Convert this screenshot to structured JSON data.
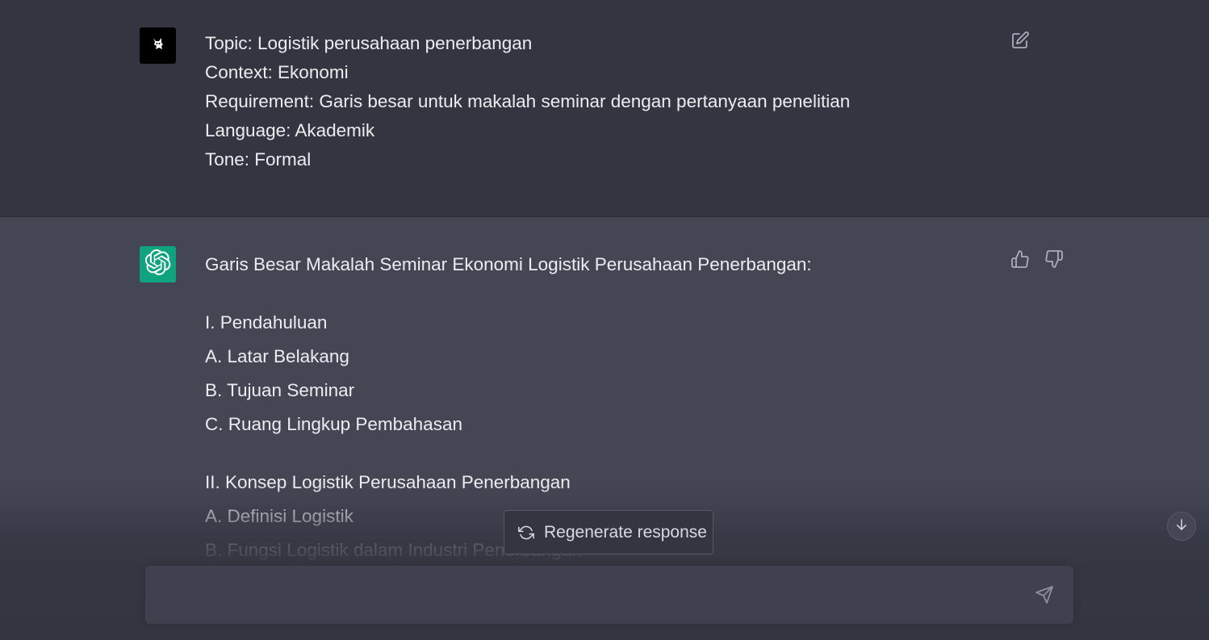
{
  "conversation": {
    "user_message": {
      "avatar_icon": "cat-avatar-icon",
      "lines": [
        "Topic: Logistik perusahaan penerbangan",
        "Context: Ekonomi",
        "Requirement: Garis besar untuk makalah seminar dengan pertanyaan penelitian",
        "Language: Akademik",
        "Tone: Formal"
      ]
    },
    "assistant_message": {
      "avatar_icon": "openai-logo-icon",
      "heading": "Garis Besar Makalah Seminar Ekonomi Logistik Perusahaan Penerbangan:",
      "sections": [
        {
          "title": "I. Pendahuluan",
          "items": [
            "A. Latar Belakang",
            "B. Tujuan Seminar",
            "C. Ruang Lingkup Pembahasan"
          ]
        },
        {
          "title": "II. Konsep Logistik Perusahaan Penerbangan",
          "items": [
            "A. Definisi Logistik",
            "B. Fungsi Logistik dalam Industri Penerbangan"
          ]
        }
      ]
    }
  },
  "actions": {
    "regenerate_label": "Regenerate response"
  },
  "composer": {
    "value": "",
    "placeholder": ""
  },
  "colors": {
    "user_bg": "#343541",
    "assistant_bg": "#444654",
    "bot_avatar": "#10a37f",
    "text": "#ececf1"
  }
}
